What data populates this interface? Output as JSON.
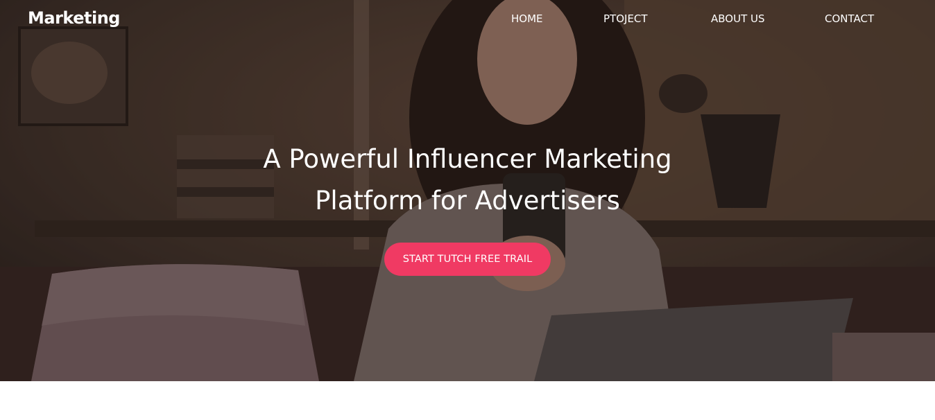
{
  "navbar": {
    "logo": "Marketing",
    "links": [
      {
        "label": "HOME"
      },
      {
        "label": "PTOJECT"
      },
      {
        "label": "ABOUT US"
      },
      {
        "label": "CONTACT"
      }
    ]
  },
  "hero": {
    "title_line1": "A Powerful Influencer Marketing",
    "title_line2": "Platform for Advertisers",
    "cta_label": "START TUTCH FREE TRAIL",
    "background_image": "woman-smiling-at-phone-photo"
  },
  "colors": {
    "accent": "#f03a63",
    "text_on_hero": "#ffffff",
    "page_background": "#ffffff"
  }
}
